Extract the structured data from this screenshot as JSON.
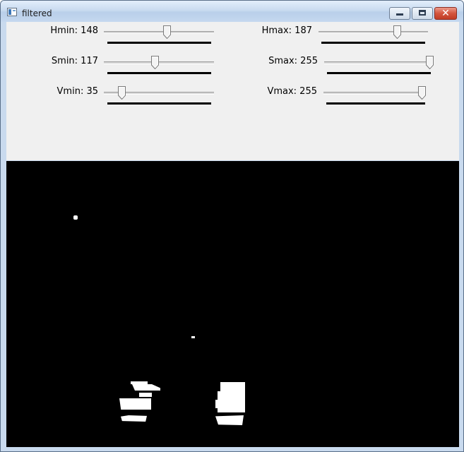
{
  "window": {
    "title": "filtered",
    "buttons": {
      "minimize": "minimize-icon",
      "maximize": "maximize-icon",
      "close": "✕"
    }
  },
  "trackbars": [
    {
      "label": "Hmin: 148",
      "value": 148,
      "max": 255
    },
    {
      "label": "Hmax: 187",
      "value": 187,
      "max": 255
    },
    {
      "label": "Smin: 117",
      "value": 117,
      "max": 255
    },
    {
      "label": "Smax: 255",
      "value": 255,
      "max": 255
    },
    {
      "label": "Vmin: 35",
      "value": 35,
      "max": 255
    },
    {
      "label": "Vmax: 255",
      "value": 255,
      "max": 255
    }
  ],
  "colors": {
    "panel_background": "#f0f0f0",
    "image_background": "#000000",
    "mask_foreground": "#ffffff",
    "close_button": "#c84a34"
  }
}
